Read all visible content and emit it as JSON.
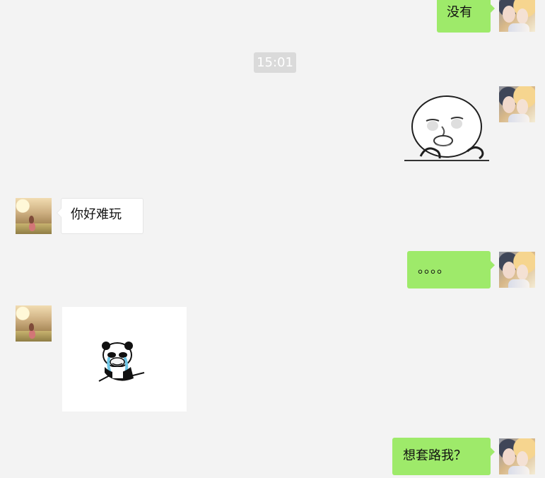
{
  "chat": {
    "messages": [
      {
        "text": "没有"
      },
      {
        "time": "15:01"
      },
      {
        "sticker": "shocked-face-sticker"
      },
      {
        "text": "你好难玩"
      },
      {
        "text": "。。。。"
      },
      {
        "sticker": "crying-panda-sticker"
      },
      {
        "text": "想套路我？"
      }
    ]
  },
  "colors": {
    "background": "#f3f3f3",
    "outgoing_bubble": "#9eea6a",
    "incoming_bubble": "#ffffff",
    "timestamp_chip": "#dadada"
  }
}
